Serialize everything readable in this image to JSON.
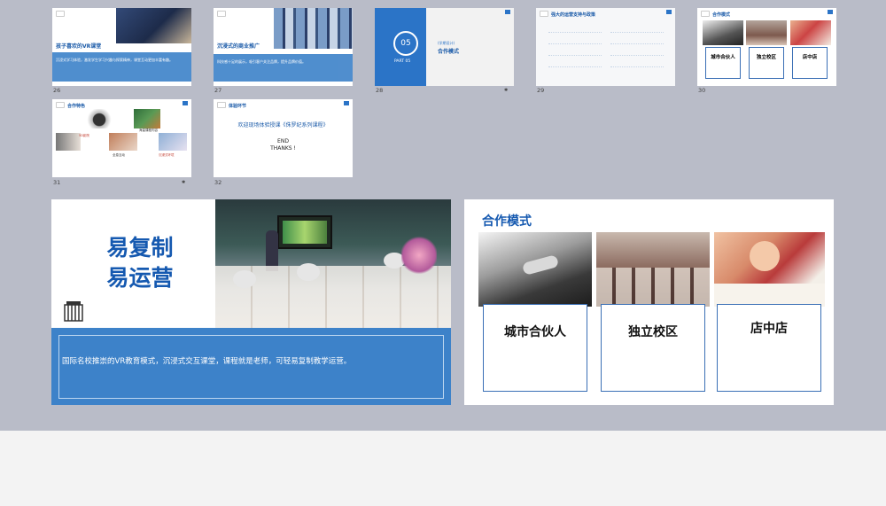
{
  "thumbnails": [
    {
      "num": "26",
      "title": "孩子喜欢的VR课堂",
      "caption": "沉浸式学习体验，激发学生学习兴趣与探索精神，课堂互动更加丰富有趣。"
    },
    {
      "num": "27",
      "title": "沉浸式的商业推广",
      "caption": "科技感十足的展示，吸引客户关注品牌，提升品牌价值。"
    },
    {
      "num": "28",
      "title": "合作模式",
      "part": "PART 05",
      "big": "05",
      "small": "(学期设计)"
    },
    {
      "num": "29",
      "title": "强大的运营支持与政策"
    },
    {
      "num": "30",
      "title": "合作模式",
      "cards": [
        "城市合伙人",
        "独立校区",
        "店中店"
      ]
    },
    {
      "num": "31",
      "title": "合作特色",
      "labels": [
        "5D影院",
        "海量课程内容",
        "全息互动",
        "沉浸式环境"
      ]
    },
    {
      "num": "32",
      "title": "体验环节",
      "line1": "欢迎现场体验授课《侏罗纪系列课程》",
      "line2": "END",
      "line3": "THANKS !"
    }
  ],
  "slide_left": {
    "title_line1": "易复制",
    "title_line2": "易运营",
    "caption": "国际名校推崇的VR教育模式，沉浸式交互课堂，课程就是老师，可轻易复制教学运营。"
  },
  "slide_right": {
    "title": "合作模式",
    "cards": [
      "城市合伙人",
      "独立校区",
      "店中店"
    ]
  },
  "colors": {
    "accent": "#1559b0",
    "panel": "#3d82c9",
    "stage": "#b9bcc8"
  }
}
